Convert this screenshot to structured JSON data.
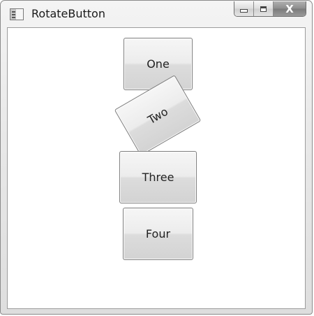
{
  "window": {
    "title": "RotateButton",
    "icon": "app-window-icon",
    "caption_buttons": {
      "minimize": "minimize-icon",
      "maximize": "maximize-icon",
      "close_glyph": "X"
    }
  },
  "buttons": [
    {
      "label": "One",
      "rotation_deg": 0
    },
    {
      "label": "Two",
      "rotation_deg": -30
    },
    {
      "label": "Three",
      "rotation_deg": 0
    },
    {
      "label": "Four",
      "rotation_deg": 0
    }
  ]
}
